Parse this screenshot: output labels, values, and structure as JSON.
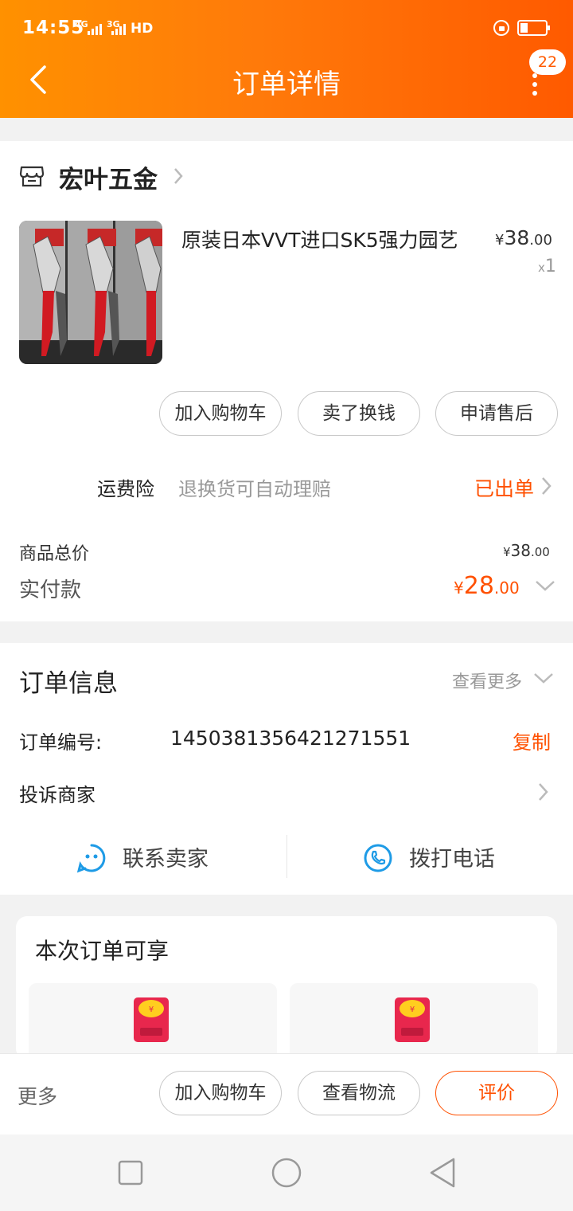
{
  "status_bar": {
    "time": "14:55",
    "net1": "4G",
    "net2": "3G",
    "hd": "HD"
  },
  "header": {
    "title": "订单详情",
    "badge": "22"
  },
  "shop": {
    "name": "宏叶五金"
  },
  "product": {
    "name": "原装日本VVT进口SK5强力园艺",
    "price_yen": "¥",
    "price_int": "38",
    "price_dec": ".00",
    "qty_x": "x",
    "qty": "1"
  },
  "actions": {
    "add_cart": "加入购物车",
    "sell": "卖了换钱",
    "after_sale": "申请售后"
  },
  "insurance": {
    "title": "运费险",
    "desc": "退换货可自动理赔",
    "status": "已出单"
  },
  "totals": {
    "goods_label": "商品总价",
    "goods_yen": "¥",
    "goods_int": "38",
    "goods_dec": ".00",
    "paid_label": "实付款",
    "paid_yen": "¥",
    "paid_int": "28",
    "paid_dec": ".00"
  },
  "order_info": {
    "title": "订单信息",
    "more": "查看更多",
    "number_label": "订单编号:",
    "number": "1450381356421271551",
    "copy": "复制",
    "complain": "投诉商家",
    "contact_seller": "联系卖家",
    "call": "拨打电话"
  },
  "benefits": {
    "title": "本次订单可享"
  },
  "bottom": {
    "more": "更多",
    "add_cart": "加入购物车",
    "logistics": "查看物流",
    "rate": "评价"
  },
  "colors": {
    "accent": "#ff5000",
    "header_start": "#ff9100",
    "header_end": "#ff5a00"
  }
}
